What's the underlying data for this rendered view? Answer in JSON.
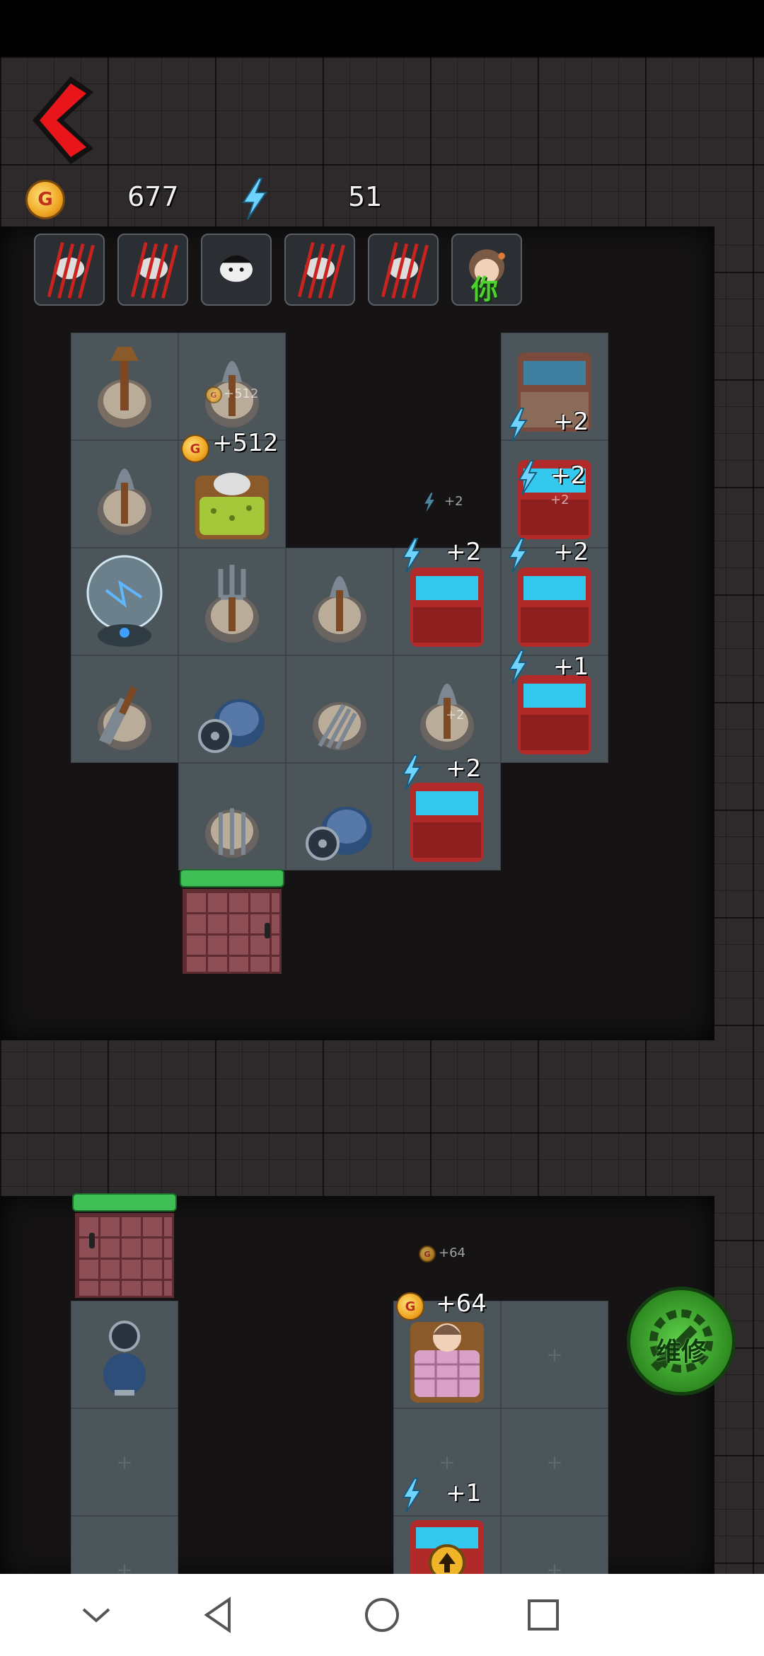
{
  "hud": {
    "gold_icon_letter": "G",
    "gold": "677",
    "energy": "51"
  },
  "avatars": [
    "ghost-slashed",
    "ghost-slashed",
    "ghost-face",
    "ghost-slashed",
    "ghost-slashed",
    "girl-you"
  ],
  "avatar_you_label": "你",
  "bonuses": {
    "coin_512_small": "+512",
    "coin_512": "+512",
    "energy_2_a": "+2",
    "energy_2_b": "+2",
    "energy_2_b_ghost": "+2",
    "energy_2_center_small": "+2",
    "energy_2_c": "+2",
    "energy_2_d": "+2",
    "energy_1": "+1",
    "energy_2_cell_small": "+2",
    "energy_2_e": "+2",
    "coin_64_small": "+64",
    "coin_64": "+64",
    "energy_1_bottom": "+1"
  },
  "repair_button": {
    "label": "维修"
  },
  "colors": {
    "accent_green": "#3fbf55",
    "back_red": "#e8151b",
    "room_floor": "#4b555a",
    "gold": "#f0a623",
    "energy": "#6fd3ff"
  },
  "navbar": {
    "icons": [
      "chevron-down-icon",
      "back-triangle-icon",
      "home-circle-icon",
      "recents-square-icon"
    ]
  }
}
